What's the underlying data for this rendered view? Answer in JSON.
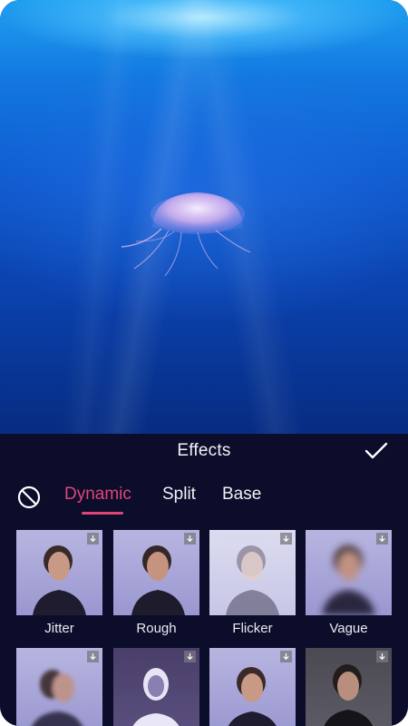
{
  "panel": {
    "title": "Effects",
    "confirm_icon": "check-icon",
    "none_icon": "no-effect-icon"
  },
  "tabs": [
    {
      "label": "Dynamic",
      "active": true
    },
    {
      "label": "Split",
      "active": false
    },
    {
      "label": "Base",
      "active": false
    }
  ],
  "colors": {
    "accent": "#e0457a",
    "panel_bg": "#0b0d2b"
  },
  "effects": [
    {
      "label": "Jitter",
      "downloadable": true
    },
    {
      "label": "Rough",
      "downloadable": true
    },
    {
      "label": "Flicker",
      "downloadable": true
    },
    {
      "label": "Vague",
      "downloadable": true
    },
    {
      "label": "",
      "downloadable": true
    },
    {
      "label": "",
      "downloadable": true
    },
    {
      "label": "",
      "downloadable": true
    },
    {
      "label": "",
      "downloadable": true
    }
  ]
}
